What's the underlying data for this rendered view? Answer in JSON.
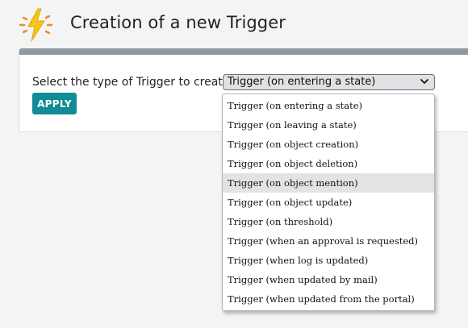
{
  "header": {
    "title": "Creation of a new Trigger",
    "icon": "lightning-bolt-icon",
    "icon_color": "#f5c518",
    "ray_color": "#f08a24"
  },
  "form": {
    "label": "Select the type of Trigger to create:",
    "selected_value": "Trigger (on entering a state)",
    "apply_label": "APPLY",
    "apply_color": "#0f8c95",
    "panel_bar_color": "#8f98a5"
  },
  "dropdown": {
    "highlighted_index": 4,
    "options": [
      {
        "label": "Trigger (on entering a state)"
      },
      {
        "label": "Trigger (on leaving a state)"
      },
      {
        "label": "Trigger (on object creation)"
      },
      {
        "label": "Trigger (on object deletion)"
      },
      {
        "label": "Trigger (on object mention)"
      },
      {
        "label": "Trigger (on object update)"
      },
      {
        "label": "Trigger (on threshold)"
      },
      {
        "label": "Trigger (when an approval is requested)"
      },
      {
        "label": "Trigger (when log is updated)"
      },
      {
        "label": "Trigger (when updated by mail)"
      },
      {
        "label": "Trigger (when updated from the portal)"
      }
    ]
  }
}
